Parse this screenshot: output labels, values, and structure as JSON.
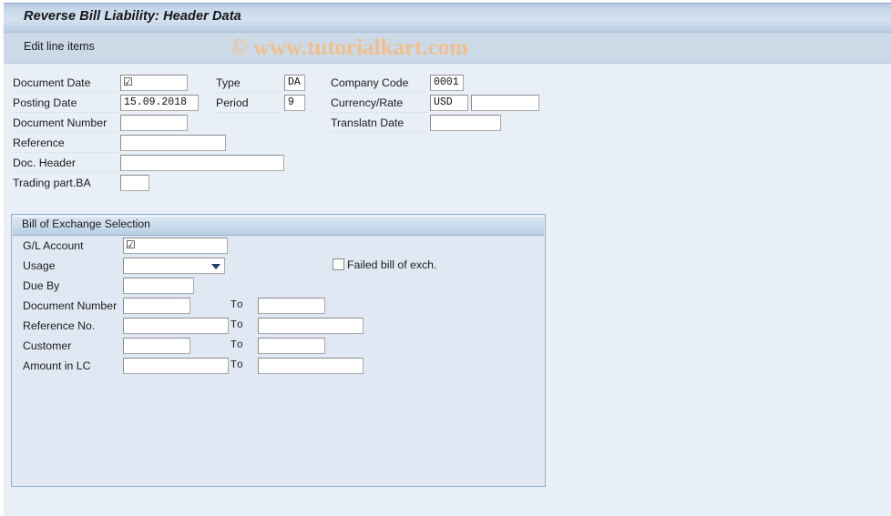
{
  "window": {
    "title": "Reverse Bill Liability: Header Data"
  },
  "toolbar": {
    "edit_line_items_label": "Edit line items"
  },
  "watermark": {
    "text": "© www.tutorialkart.com",
    "color": "#efbf8d"
  },
  "header_form": {
    "fields": [
      {
        "label": "Document Date",
        "value": "☑"
      },
      {
        "label": "Posting Date",
        "value": "15.09.2018"
      },
      {
        "label": "Document Number",
        "value": ""
      },
      {
        "label": "Reference",
        "value": ""
      },
      {
        "label": "Doc. Header",
        "value": ""
      },
      {
        "label": "Trading part.BA",
        "value": ""
      },
      {
        "label": "Type",
        "value": "DA"
      },
      {
        "label": "Period",
        "value": "9"
      },
      {
        "label": "Company Code",
        "value": "0001"
      },
      {
        "label": "Currency/Rate",
        "value": "USD"
      },
      {
        "label": "Rate",
        "value": ""
      },
      {
        "label": "Translatn Date",
        "value": ""
      }
    ]
  },
  "selection_panel": {
    "title": "Bill of Exchange Selection",
    "gl_account": {
      "label": "G/L Account",
      "value": "☑"
    },
    "usage": {
      "label": "Usage",
      "value": ""
    },
    "due_by": {
      "label": "Due By",
      "value": ""
    },
    "failed_bill": {
      "label": "Failed bill of exch.",
      "checked": false
    },
    "to_label": "To",
    "ranges": [
      {
        "label": "Document Number",
        "from": "",
        "to": ""
      },
      {
        "label": "Reference No.",
        "from": "",
        "to": ""
      },
      {
        "label": "Customer",
        "from": "",
        "to": ""
      },
      {
        "label": "Amount in LC",
        "from": "",
        "to": ""
      }
    ]
  },
  "colors": {
    "background": "#e9eff7",
    "titlebar": "#c9d9ea",
    "toolbar": "#ccdae8",
    "panel": "#e0e9f3",
    "panel_border": "#8fafd0"
  }
}
